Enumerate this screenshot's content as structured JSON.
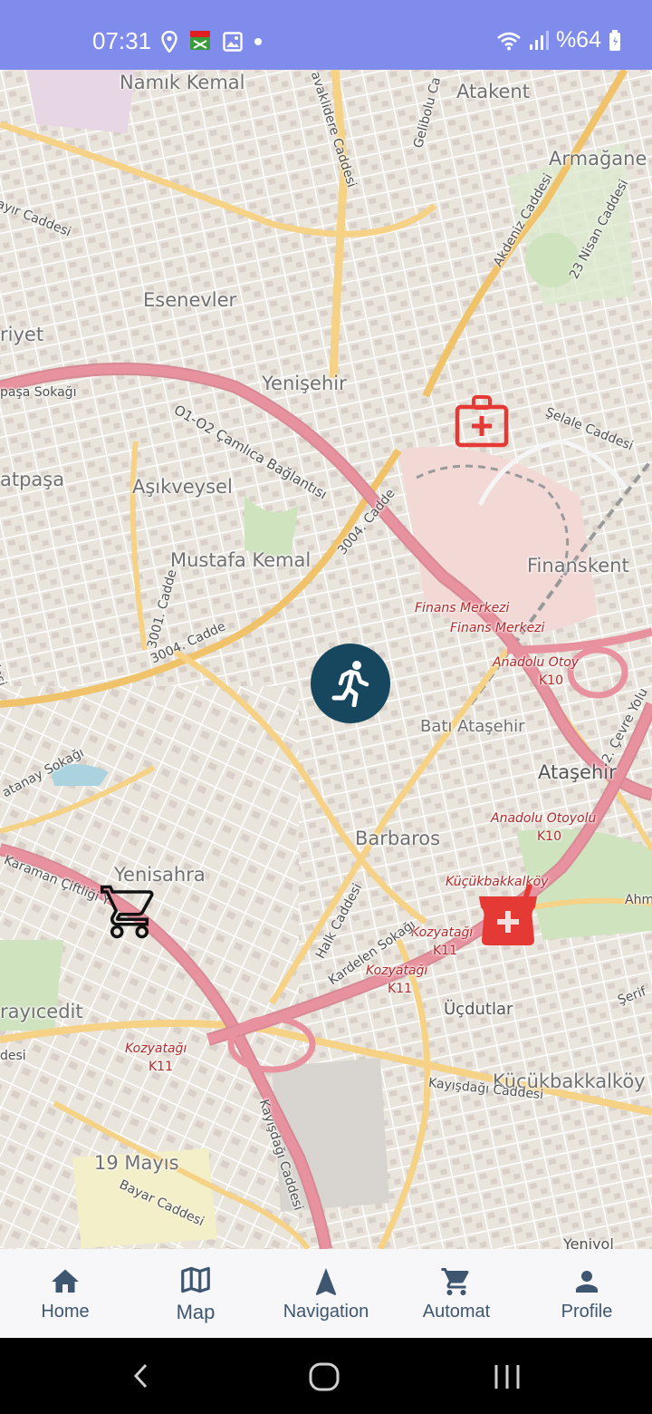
{
  "status_bar": {
    "time": "07:31",
    "battery": "%64",
    "icons": [
      "location-icon",
      "fake-gps-icon",
      "image-icon",
      "dot-icon",
      "wifi-icon",
      "signal-icon",
      "battery-icon"
    ]
  },
  "map": {
    "labels": {
      "namik_kemal": "Namık Kemal",
      "atakent": "Atakent",
      "armagan": "Armağane",
      "esenevler": "Esenevler",
      "yenisehir": "Yenişehir",
      "ataturk_fragment": "riyet",
      "atpasa": "atpaşa",
      "asikveysel": "Aşıkveysel",
      "mustafa_kemal": "Mustafa Kemal",
      "finanskent": "Finanskent",
      "bati_atasehir": "Batı Ataşehir",
      "atasehir": "Ataşehir",
      "barbaros": "Barbaros",
      "yenisahra": "Yenisahra",
      "rayicedit": "rayıcedit",
      "ucdutlar": "Üçdutlar",
      "kucukbakkalkoy": "Küçükbakkalköy",
      "kucukbakkalkoy_small": "Küçükbakkalköy",
      "mayis": "19 Mayıs",
      "yeniyol": "Yeniyol",
      "finans_merkezi_1": "Finans Merkezi",
      "finans_merkezi_2": "Finans Merkezi",
      "anadolu_otoyolu_1": "Anadolu Otoy",
      "k10_1": "K10",
      "anadolu_otoyolu_2": "Anadolu Otoyolu",
      "k10_2": "K10",
      "kozyatagi_1": "Kozyatağı",
      "k11_1": "K11",
      "kozyatagi_2": "Kozyatağı",
      "k11_2": "K11",
      "kozyatagi_3": "Kozyatağı",
      "k11_3": "K11",
      "camlica": "O1-O2 Çamlıca Bağlantısı",
      "cadde3004_a": "3004. Cadde",
      "cadde3004_b": "3004. Cadde",
      "cadde3001": "3001. Cadde",
      "akdeniz": "Akdeniz Caddesi",
      "nisan": "23 Nisan Caddesi",
      "selale": "Şelale Caddesi",
      "kayisdagi_1": "Kayışdağı Caddesi",
      "kayisdagi_2": "Kayışdağı Caddesi",
      "halk": "Halk Caddesi",
      "kardelen": "Kardelen Sokağı",
      "bayar": "Bayar Caddesi",
      "karaman": "Karaman Çiftliği Y",
      "atanay": "atanay Sokağı",
      "pasa_sokagi": "paşa Sokağı",
      "ayir": "ayır Caddesi",
      "gelibolu": "Gelibolu Ca",
      "kavaklidere": "avaklidere Caddesi",
      "cevre": "2. Çevre Yolu",
      "ahm": "Ahm",
      "serif": "Şerif",
      "desi_1": "desi",
      "desi_2": "desi"
    },
    "markers": [
      "hospital-marker",
      "pharmacy-marker",
      "shopping-cart-marker",
      "user-location-marker"
    ]
  },
  "bottom_nav": {
    "items": [
      {
        "label": "Home",
        "icon": "home-icon"
      },
      {
        "label": "Map",
        "icon": "map-icon"
      },
      {
        "label": "Navigation",
        "icon": "navigation-icon"
      },
      {
        "label": "Automat",
        "icon": "cart-icon"
      },
      {
        "label": "Profile",
        "icon": "person-icon"
      }
    ],
    "active": "Map"
  },
  "colors": {
    "status_bar": "#7f8ceb",
    "motorway": "#e8919f",
    "primary_road": "#f5d286",
    "hospital": "#e53935",
    "walker_bg": "#17475e",
    "nav_text": "#3e5670"
  }
}
